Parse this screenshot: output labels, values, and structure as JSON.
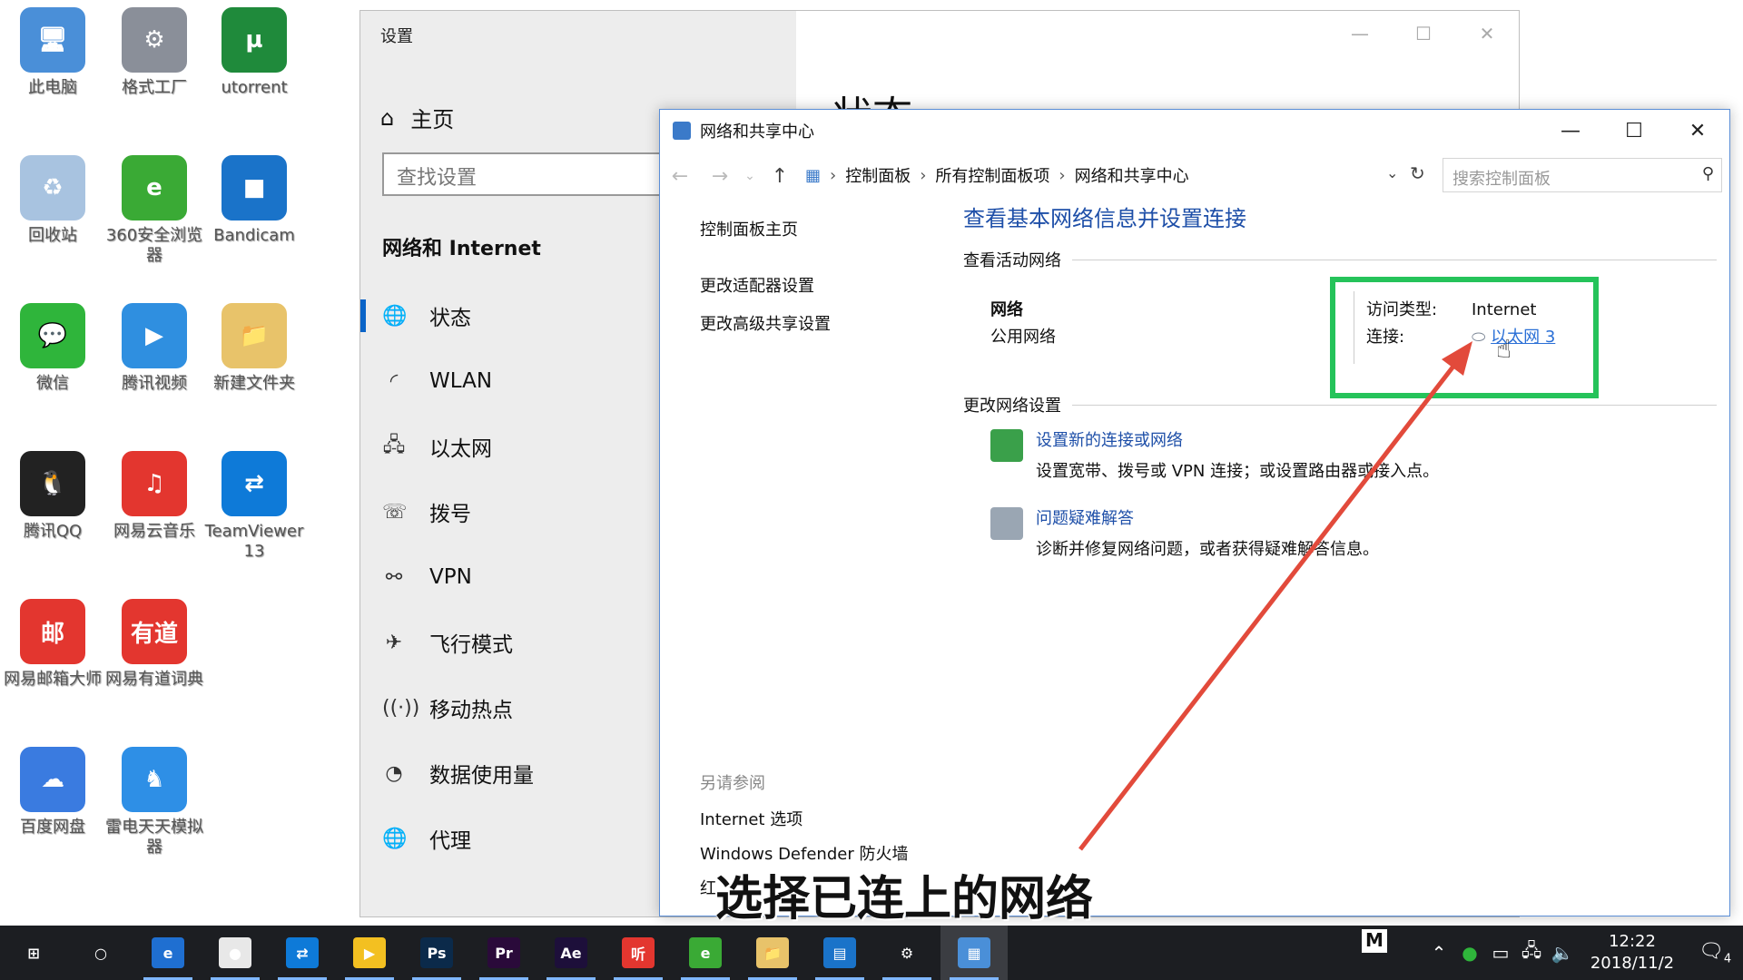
{
  "desktop": {
    "icons": [
      {
        "label": "此电脑",
        "glyph": "🖥",
        "color": "#4a8fd8"
      },
      {
        "label": "格式工厂",
        "glyph": "⚙",
        "color": "#8a8f99"
      },
      {
        "label": "utorrent",
        "glyph": "µ",
        "color": "#1f8a3b"
      },
      {
        "label": "回收站",
        "glyph": "♻",
        "color": "#a8c3e0"
      },
      {
        "label": "360安全浏览器",
        "glyph": "e",
        "color": "#3aaa35"
      },
      {
        "label": "Bandicam",
        "glyph": "■",
        "color": "#1a73c9"
      },
      {
        "label": "微信",
        "glyph": "💬",
        "color": "#2fb53b"
      },
      {
        "label": "腾讯视频",
        "glyph": "▶",
        "color": "#2f8fe0"
      },
      {
        "label": "新建文件夹",
        "glyph": "📁",
        "color": "#e8c36a"
      },
      {
        "label": "腾讯QQ",
        "glyph": "🐧",
        "color": "#222222"
      },
      {
        "label": "网易云音乐",
        "glyph": "♫",
        "color": "#e3362f"
      },
      {
        "label": "TeamViewer 13",
        "glyph": "⇄",
        "color": "#0e7ad8"
      },
      {
        "label": "网易邮箱大师",
        "glyph": "邮",
        "color": "#e3362f"
      },
      {
        "label": "网易有道词典",
        "glyph": "有道",
        "color": "#e3362f"
      },
      {
        "label": "百度网盘",
        "glyph": "☁",
        "color": "#3a7be0"
      },
      {
        "label": "雷电天天模拟器",
        "glyph": "♞",
        "color": "#2e8fe6"
      }
    ]
  },
  "settings": {
    "window_title": "设置",
    "home_label": "主页",
    "search_placeholder": "查找设置",
    "category_title": "网络和 Internet",
    "nav": [
      {
        "label": "状态",
        "icon": "globe-icon",
        "glyph": "🌐"
      },
      {
        "label": "WLAN",
        "icon": "wifi-icon",
        "glyph": "◜"
      },
      {
        "label": "以太网",
        "icon": "ethernet-icon",
        "glyph": "🖧"
      },
      {
        "label": "拨号",
        "icon": "dialup-icon",
        "glyph": "☏"
      },
      {
        "label": "VPN",
        "icon": "vpn-icon",
        "glyph": "⚯"
      },
      {
        "label": "飞行模式",
        "icon": "airplane-icon",
        "glyph": "✈"
      },
      {
        "label": "移动热点",
        "icon": "hotspot-icon",
        "glyph": "((·))"
      },
      {
        "label": "数据使用量",
        "icon": "data-usage-icon",
        "glyph": "◔"
      },
      {
        "label": "代理",
        "icon": "proxy-icon",
        "glyph": "🌐"
      }
    ],
    "page_heading": "状态"
  },
  "network_center": {
    "window_title": "网络和共享中心",
    "breadcrumbs": [
      "控制面板",
      "所有控制面板项",
      "网络和共享中心"
    ],
    "search_placeholder": "搜索控制面板",
    "left_links": [
      "控制面板主页",
      "更改适配器设置",
      "更改高级共享设置"
    ],
    "see_also_header": "另请参阅",
    "see_also": [
      "Internet 选项",
      "Windows Defender 防火墙",
      "红"
    ],
    "main_title": "查看基本网络信息并设置连接",
    "active_networks_header": "查看活动网络",
    "network_name": "网络",
    "network_type": "公用网络",
    "access_type_label": "访问类型:",
    "access_type_value": "Internet",
    "connection_label": "连接:",
    "connection_value": "以太网 3",
    "change_settings_header": "更改网络设置",
    "tasks": [
      {
        "title": "设置新的连接或网络",
        "desc": "设置宽带、拨号或 VPN 连接；或设置路由器或接入点。"
      },
      {
        "title": "问题疑难解答",
        "desc": "诊断并修复网络问题，或者获得疑难解答信息。"
      }
    ]
  },
  "subtitle": "选择已连上的网络",
  "taskbar": {
    "apps": [
      {
        "name": "start-button",
        "glyph": "⊞",
        "bg": ""
      },
      {
        "name": "cortana-button",
        "glyph": "○",
        "bg": ""
      },
      {
        "name": "edge-app",
        "glyph": "e",
        "bg": "#1f6fd1"
      },
      {
        "name": "app-4",
        "glyph": "●",
        "bg": "#e8e8e8"
      },
      {
        "name": "teamviewer-app",
        "glyph": "⇄",
        "bg": "#0e7ad8"
      },
      {
        "name": "player-app",
        "glyph": "▶",
        "bg": "#f3c021"
      },
      {
        "name": "photoshop-app",
        "glyph": "Ps",
        "bg": "#0b2a4a"
      },
      {
        "name": "premiere-app",
        "glyph": "Pr",
        "bg": "#2a0a3a"
      },
      {
        "name": "aftereffects-app",
        "glyph": "Ae",
        "bg": "#1d0f3a"
      },
      {
        "name": "listen-app",
        "glyph": "听",
        "bg": "#e3362f"
      },
      {
        "name": "browser-360-app",
        "glyph": "e",
        "bg": "#3aaa35"
      },
      {
        "name": "explorer-app",
        "glyph": "📁",
        "bg": "#e8c36a"
      },
      {
        "name": "window-app",
        "glyph": "▤",
        "bg": "#1a73c9"
      },
      {
        "name": "settings-app",
        "glyph": "⚙",
        "bg": ""
      },
      {
        "name": "control-panel-app",
        "glyph": "▦",
        "bg": "#4a8fd8"
      }
    ],
    "ime_badge": "M",
    "time": "12:22",
    "date": "2018/11/2",
    "notification_count": "4"
  }
}
